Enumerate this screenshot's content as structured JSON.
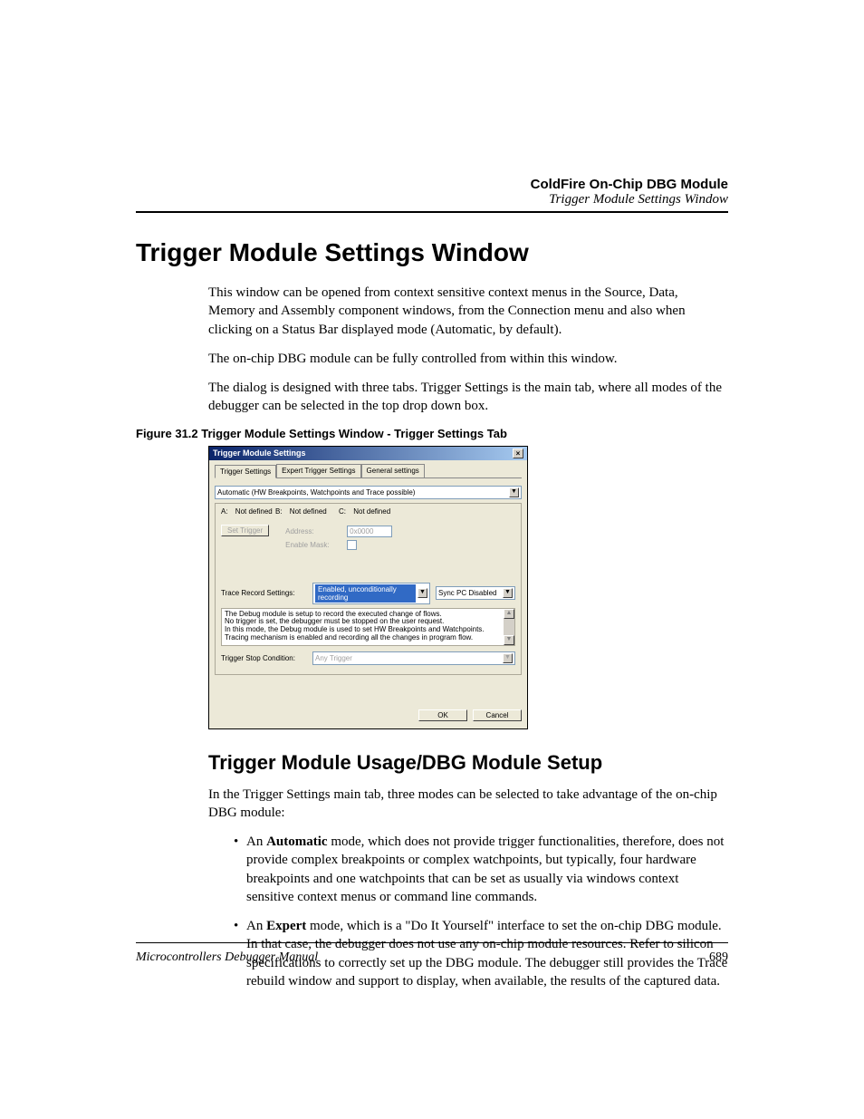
{
  "header": {
    "chapter": "ColdFire On-Chip DBG Module",
    "section": "Trigger Module Settings Window"
  },
  "h1": "Trigger Module Settings Window",
  "intro": {
    "p1": "This window can be opened from context sensitive context menus in the Source, Data, Memory and Assembly component windows, from the Connection menu and also when clicking on a Status Bar displayed mode (Automatic, by default).",
    "p2": "The on-chip DBG module can be fully controlled from within this window.",
    "p3": "The dialog is designed with three tabs. Trigger Settings is the main tab, where all modes of the debugger can be selected in the top drop down box."
  },
  "figure_caption": "Figure 31.2  Trigger Module Settings Window - Trigger Settings Tab",
  "dialog": {
    "title": "Trigger Module Settings",
    "tabs": [
      "Trigger Settings",
      "Expert Trigger Settings",
      "General settings"
    ],
    "mode_combo": "Automatic (HW Breakpoints, Watchpoints and Trace possible)",
    "abc": {
      "a_label": "A:",
      "a_val": "Not defined",
      "b_label": "B:",
      "b_val": "Not defined",
      "c_label": "C:",
      "c_val": "Not defined"
    },
    "set_trigger_btn": "Set Trigger",
    "address_label": "Address:",
    "address_value": "0x0000",
    "mask_label": "Enable Mask:",
    "trace_label": "Trace Record Settings:",
    "trace_value": "Enabled, unconditionally recording",
    "sync_value": "Sync PC Disabled",
    "info_lines": [
      "The Debug module is setup to record the executed change of flows.",
      "No trigger is set, the debugger must be stopped on the user request.",
      "In this mode, the Debug module is used to set HW Breakpoints and Watchpoints.",
      "Tracing mechanism is enabled and recording all the changes in program flow."
    ],
    "stop_label": "Trigger Stop Condition:",
    "stop_value": "Any Trigger",
    "ok": "OK",
    "cancel": "Cancel"
  },
  "h2": "Trigger Module Usage/DBG Module Setup",
  "body2": {
    "p1": "In the Trigger Settings main tab, three modes can be selected to take advantage of the on-chip DBG module:",
    "bullet1_pre": "An ",
    "bullet1_bold": "Automatic",
    "bullet1_post": " mode, which does not provide trigger functionalities, therefore, does not provide complex breakpoints or complex watchpoints, but typically, four hardware breakpoints and one watchpoints that can be set as usually via windows context sensitive context menus or command line commands.",
    "bullet2_pre": "An ",
    "bullet2_bold": "Expert",
    "bullet2_post": " mode, which is a \"Do It Yourself\" interface to set the on-chip DBG module. In that case, the debugger does not use any on-chip module resources. Refer to silicon specifications to correctly set up the DBG module. The debugger still provides the Trace rebuild window and support to display, when available, the results of the captured data."
  },
  "footer": {
    "manual": "Microcontrollers Debugger Manual",
    "page": "689"
  }
}
